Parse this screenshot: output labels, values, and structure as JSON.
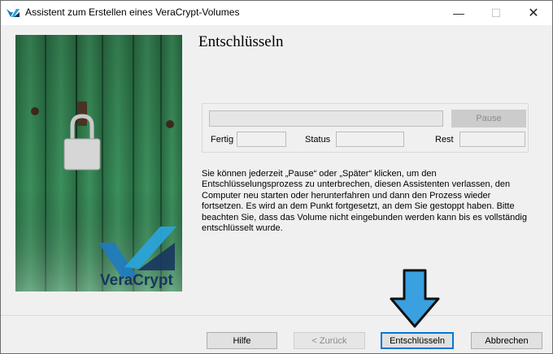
{
  "window": {
    "title": "Assistent zum Erstellen eines VeraCrypt-Volumes",
    "controls": {
      "minimize": "—",
      "maximize": "☐",
      "close": "✕"
    }
  },
  "side_image": {
    "logo_text": "VeraCrypt"
  },
  "page": {
    "title": "Entschlüsseln",
    "progress": {
      "value": 0,
      "pause_label": "Pause",
      "done_label": "Fertig",
      "status_label": "Status",
      "rest_label": "Rest",
      "done_value": "",
      "status_value": "",
      "rest_value": ""
    },
    "description": "Sie können jederzeit „Pause“ oder „Später“ klicken, um den Entschlüsselungsprozess zu unterbrechen, diesen Assistenten verlassen, den Computer neu starten oder herunterfahren und dann den Prozess wieder fortsetzen. Es wird an dem Punkt fortgesetzt, an dem Sie gestoppt haben. Bitte beachten Sie, dass das Volume nicht eingebunden werden kann bis es vollständig entschlüsselt wurde."
  },
  "buttons": {
    "help": "Hilfe",
    "back": "< Zurück",
    "decrypt": "Entschlüsseln",
    "cancel": "Abbrechen"
  },
  "colors": {
    "accent": "#0078d7",
    "arrow_fill": "#3aa0e0",
    "door_green": "#2f7a4d",
    "logo_blue": "#1f7bc1"
  }
}
